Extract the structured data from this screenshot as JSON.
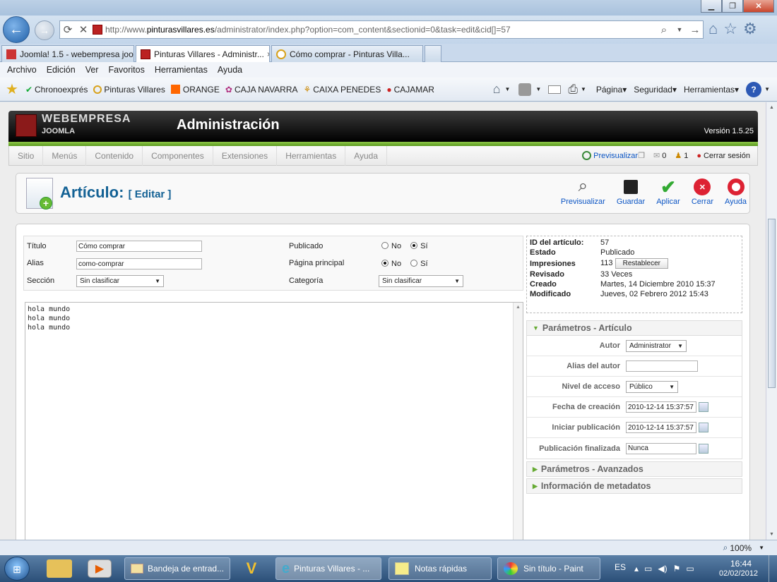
{
  "browser": {
    "address_url_prefix": "http://www.",
    "address_url_domain": "pinturasvillares.es",
    "address_url_path": "/administrator/index.php?option=com_content&sectionid=0&task=edit&cid[]=57",
    "tabs": [
      {
        "label": "Joomla! 1.5 - webempresa joo..."
      },
      {
        "label": "Pinturas Villares - Administr..."
      },
      {
        "label": "Cómo comprar - Pinturas Villa..."
      }
    ],
    "tab_close": "×",
    "menu": [
      "Archivo",
      "Edición",
      "Ver",
      "Favoritos",
      "Herramientas",
      "Ayuda"
    ],
    "favorites": [
      "Chronoexprés",
      "Pinturas Villares",
      "ORANGE",
      "CAJA NAVARRA",
      "CAIXA PENEDES",
      "CAJAMAR"
    ],
    "commands": [
      "Página",
      "Seguridad",
      "Herramientas"
    ],
    "zoom": "100%"
  },
  "joomla": {
    "brand_top": "WEBEMPRESA",
    "brand_bottom": "JOOMLA",
    "header_title": "Administración",
    "version": "Versión 1.5.25",
    "menu": [
      "Sitio",
      "Menús",
      "Contenido",
      "Componentes",
      "Extensiones",
      "Herramientas",
      "Ayuda"
    ],
    "preview_link": "Previsualizar",
    "messages_count": "0",
    "users_count": "1",
    "logout": "Cerrar sesión",
    "page_title": "Artículo:",
    "page_subtitle": "[ Editar ]",
    "toolbar": [
      "Previsualizar",
      "Guardar",
      "Aplicar",
      "Cerrar",
      "Ayuda"
    ]
  },
  "form": {
    "titulo_label": "Título",
    "titulo_value": "Cómo comprar",
    "alias_label": "Alias",
    "alias_value": "como-comprar",
    "seccion_label": "Sección",
    "seccion_value": "Sin clasificar",
    "publicado_label": "Publicado",
    "pagina_principal_label": "Página principal",
    "categoria_label": "Categoría",
    "categoria_value": "Sin clasificar",
    "radio_no": "No",
    "radio_si": "Sí",
    "publicado_selected": "Sí",
    "pagina_principal_selected": "No",
    "editor_text": "hola mundo\nhola mundo\nhola mundo"
  },
  "info": [
    {
      "label": "ID del artículo:",
      "value": "57"
    },
    {
      "label": "Estado",
      "value": "Publicado"
    },
    {
      "label": "Impresiones",
      "value": "113"
    },
    {
      "label": "Revisado",
      "value": "33 Veces"
    },
    {
      "label": "Creado",
      "value": "Martes, 14 Diciembre 2010 15:37"
    },
    {
      "label": "Modificado",
      "value": "Jueves, 02 Febrero 2012 15:43"
    }
  ],
  "reset_button": "Restablecer",
  "params": {
    "header": "Parámetros - Artículo",
    "autor_label": "Autor",
    "autor_value": "Administrator",
    "alias_autor_label": "Alias del autor",
    "alias_autor_value": "",
    "nivel_label": "Nivel de acceso",
    "nivel_value": "Público",
    "fecha_creacion_label": "Fecha de creación",
    "fecha_creacion_value": "2010-12-14 15:37:57",
    "iniciar_label": "Iniciar publicación",
    "iniciar_value": "2010-12-14 15:37:57",
    "finalizada_label": "Publicación finalizada",
    "finalizada_value": "Nunca",
    "advanced_header": "Parámetros - Avanzados",
    "meta_header": "Información de metadatos"
  },
  "taskbar": {
    "items": [
      "Bandeja de entrad...",
      "Pinturas Villares - ...",
      "Notas rápidas",
      "Sin título - Paint"
    ],
    "lang": "ES",
    "time": "16:44",
    "date": "02/02/2012"
  },
  "colors": {
    "accent_blue": "#0b55c4",
    "joomla_green": "#6aab2a",
    "header_black": "#000000"
  }
}
